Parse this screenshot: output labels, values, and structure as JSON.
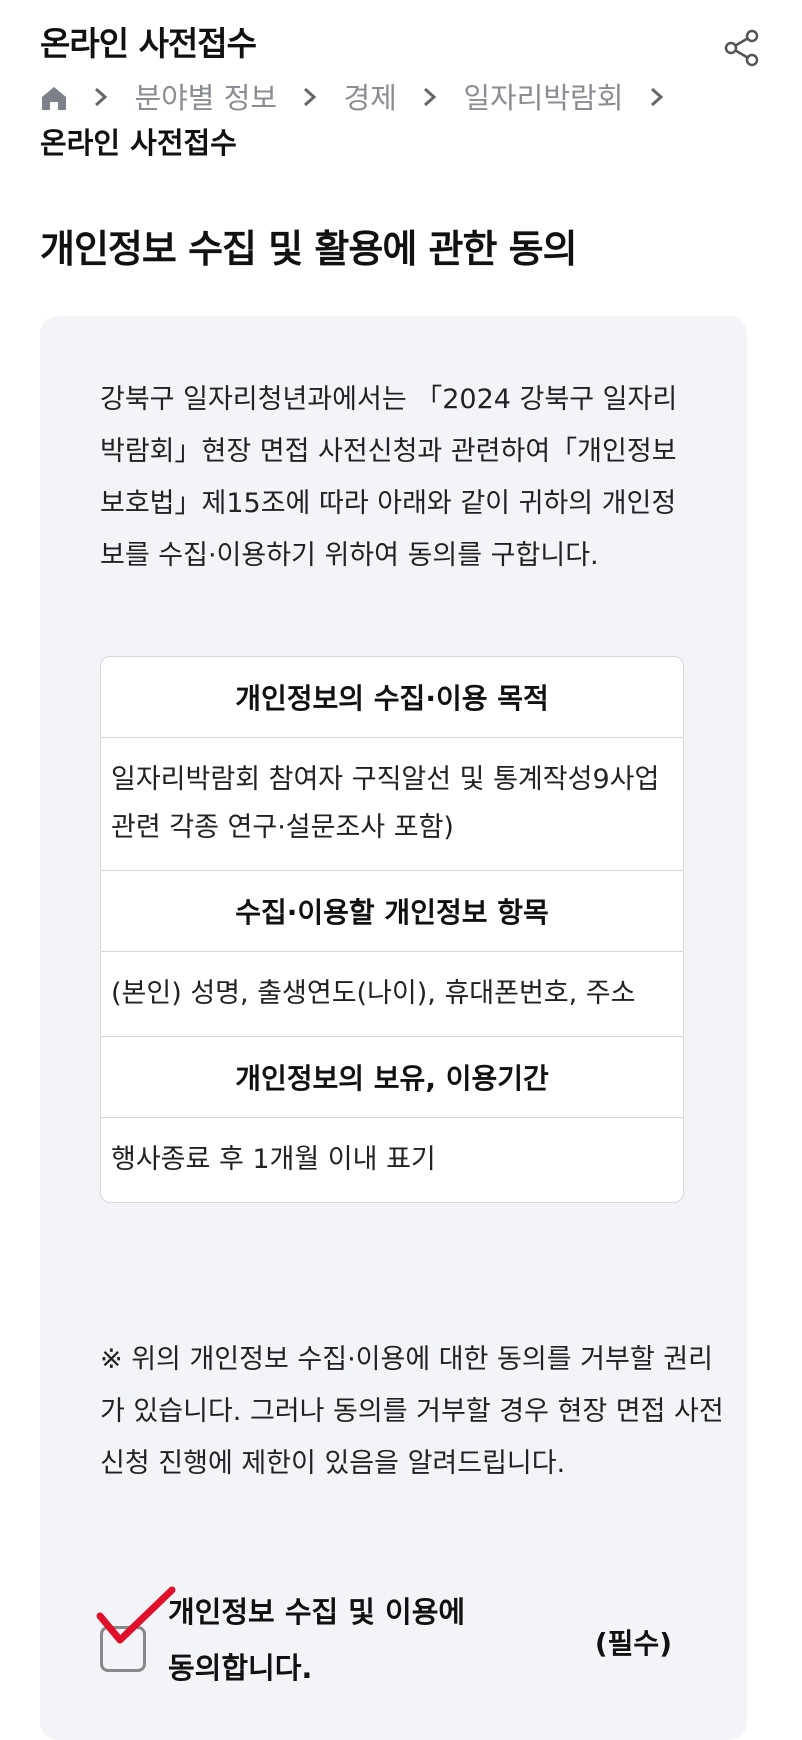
{
  "header": {
    "title": "온라인 사전접수"
  },
  "breadcrumb": {
    "items": [
      "분야별 정보",
      "경제",
      "일자리박람회"
    ],
    "current": "온라인 사전접수"
  },
  "section": {
    "title": "개인정보 수집 및 활용에 관한 동의"
  },
  "intro": "강북구 일자리청년과에서는 「2024 강북구 일자리박람회」현장 면접 사전신청과 관련하여「개인정보보호법」제15조에 따라 아래와 같이 귀하의 개인정보를 수집·이용하기 위하여 동의를 구합니다.",
  "table": [
    {
      "header": "개인정보의 수집·이용 목적",
      "value": "일자리박람회 참여자 구직알선 및 통계작성9사업 관련 각종 연구·설문조사 포함)"
    },
    {
      "header": "수집·이용할 개인정보 항목",
      "value": "(본인) 성명, 출생연도(나이), 휴대폰번호, 주소"
    },
    {
      "header": "개인정보의 보유, 이용기간",
      "value": "행사종료 후 1개월 이내 표기"
    }
  ],
  "notice": "※ 위의 개인정보 수집·이용에 대한 동의를 거부할 권리가 있습니다. 그러나 동의를 거부할 경우 현장 면접 사전 신청 진행에 제한이 있음을 알려드립니다.",
  "consent": {
    "label": "개인정보 수집 및 이용에 동의합니다.",
    "required": "(필수)",
    "checked": true
  },
  "icons": {
    "share": "share-icon",
    "home": "home-icon",
    "separator": "chevron-right-icon",
    "check": "check-icon"
  },
  "colors": {
    "check": "#e0102a",
    "card_bg": "#f3f4f8",
    "muted": "#8a8d93"
  }
}
